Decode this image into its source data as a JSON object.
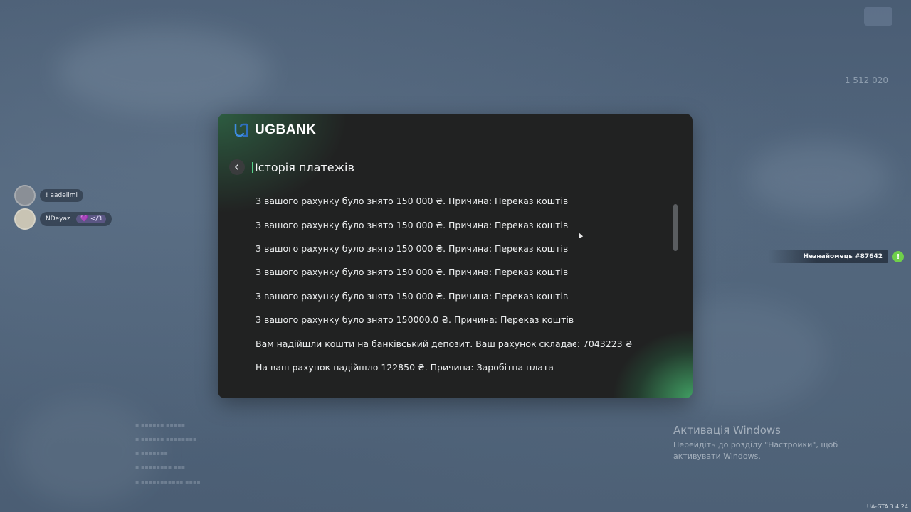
{
  "bank": {
    "brand": "UGBANK",
    "title": "Історія платежів",
    "transactions": [
      "З вашого рахунку було знято 150 000 ₴. Причина: Переказ коштів",
      "З вашого рахунку було знято 150 000 ₴. Причина: Переказ коштів",
      "З вашого рахунку було знято 150 000 ₴. Причина: Переказ коштів",
      "З вашого рахунку було знято 150 000 ₴. Причина: Переказ коштів",
      "З вашого рахунку було знято 150 000 ₴. Причина: Переказ коштів",
      "З вашого рахунку було знято 150000.0 ₴. Причина: Переказ коштів",
      "Вам надійшли кошти на банківський депозит. Ваш рахунок складає: 7043223 ₴",
      "На ваш рахунок надійшло 122850 ₴. Причина: Заробітна плата"
    ]
  },
  "players": [
    {
      "name": "! aadellmi",
      "badge": ""
    },
    {
      "name": "NDeyaz",
      "badge": "💜 </3"
    }
  ],
  "hud": {
    "money": "1 512 020",
    "stranger": "Незнайомець #87642",
    "stranger_icon": "!"
  },
  "windows_activation": {
    "title": "Активація Windows",
    "message": "Перейдіть до розділу \"Настройки\", щоб активувати Windows."
  },
  "version": "UA-GTA 3.4  24",
  "colors": {
    "accent_green": "#58d08a",
    "panel_bg": "#212222",
    "stranger_dot": "#6fcf4a"
  }
}
